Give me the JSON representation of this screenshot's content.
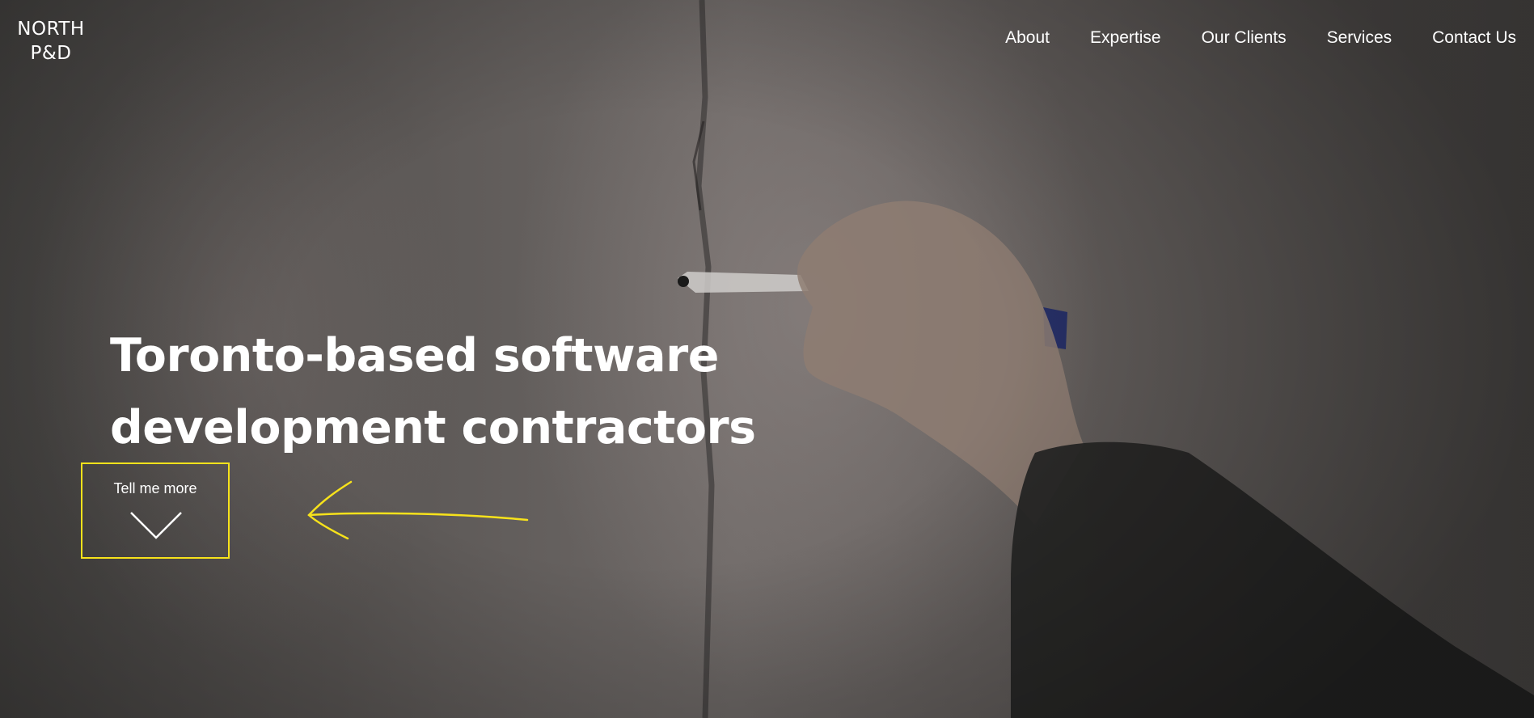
{
  "brand": {
    "line1": "NORTH",
    "line2": "P&D"
  },
  "nav": {
    "items": [
      "About",
      "Expertise",
      "Our Clients",
      "Services",
      "Contact Us"
    ]
  },
  "hero": {
    "headline": "Toronto-based software development contractors",
    "cta_label": "Tell me more"
  },
  "colors": {
    "highlight": "#f7e21b",
    "text": "#ffffff"
  },
  "icons": {
    "cta": "chevron-down-icon",
    "annotation": "arrow-left-icon"
  }
}
